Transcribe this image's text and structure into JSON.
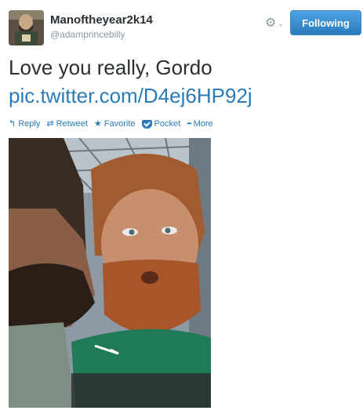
{
  "user": {
    "display_name": "Manoftheyear2k14",
    "handle": "@adamprincebilly",
    "avatar_icon": "avatar-photo"
  },
  "header": {
    "gear_icon": "gear-icon",
    "gear_glyph": "⚙",
    "caret_glyph": "⌄",
    "follow_label": "Following"
  },
  "tweet": {
    "text": "Love you really, Gordo",
    "link": "pic.twitter.com/D4ej6HP92j"
  },
  "actions": [
    {
      "icon": "reply-icon",
      "glyph": "↰",
      "label": "Reply"
    },
    {
      "icon": "retweet-icon",
      "glyph": "⇄",
      "label": "Retweet"
    },
    {
      "icon": "star-icon",
      "glyph": "★",
      "label": "Favorite"
    },
    {
      "icon": "pocket-icon",
      "glyph": "",
      "label": "Pocket"
    },
    {
      "icon": "more-icon",
      "glyph": "•••",
      "label": "More"
    }
  ],
  "colors": {
    "link": "#2b7bb9",
    "button": "#3b94d9",
    "muted": "#8899a6",
    "text": "#292f33"
  }
}
